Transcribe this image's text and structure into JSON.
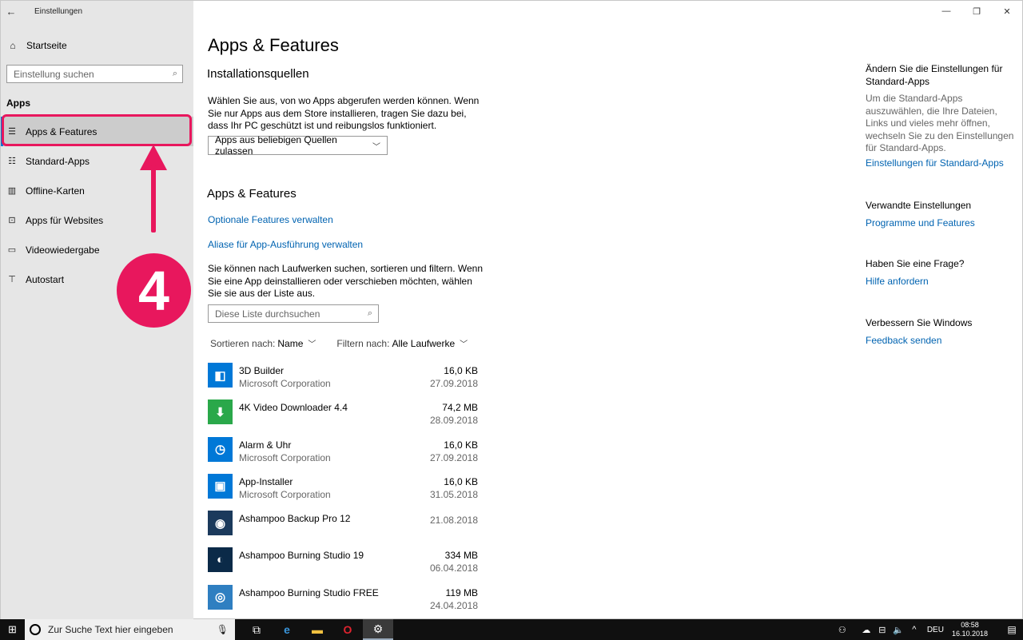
{
  "window": {
    "title": "Einstellungen",
    "controls": [
      "—",
      "❐",
      "✕"
    ]
  },
  "sidebar": {
    "home_label": "Startseite",
    "search_placeholder": "Einstellung suchen",
    "section_title": "Apps",
    "items": [
      {
        "label": "Apps & Features",
        "icon": "list-icon",
        "active": true
      },
      {
        "label": "Standard-Apps",
        "icon": "list-check-icon"
      },
      {
        "label": "Offline-Karten",
        "icon": "map-icon"
      },
      {
        "label": "Apps für Websites",
        "icon": "external-window-icon"
      },
      {
        "label": "Videowiedergabe",
        "icon": "video-icon"
      },
      {
        "label": "Autostart",
        "icon": "startup-icon"
      }
    ]
  },
  "annotation": {
    "step_number": "4",
    "accent_color": "#e8175d"
  },
  "main": {
    "title": "Apps & Features",
    "install_sources": {
      "heading": "Installationsquellen",
      "description": "Wählen Sie aus, von wo Apps abgerufen werden können. Wenn Sie nur Apps aus dem Store installieren, tragen Sie dazu bei, dass Ihr PC geschützt ist und reibungslos funktioniert.",
      "dropdown_value": "Apps aus beliebigen Quellen zulassen"
    },
    "apps_features": {
      "heading": "Apps & Features",
      "link_optional": "Optionale Features verwalten",
      "link_alias": "Aliase für App-Ausführung verwalten",
      "description": "Sie können nach Laufwerken suchen, sortieren und filtern. Wenn Sie eine App deinstallieren oder verschieben möchten, wählen Sie sie aus der Liste aus.",
      "search_placeholder": "Diese Liste durchsuchen",
      "sort_label": "Sortieren nach:",
      "sort_value": "Name",
      "filter_label": "Filtern nach:",
      "filter_value": "Alle Laufwerke"
    },
    "apps": [
      {
        "name": "3D Builder",
        "publisher": "Microsoft Corporation",
        "size": "16,0 KB",
        "date": "27.09.2018",
        "icon_color": "#0078d7",
        "icon": "3d-builder-icon"
      },
      {
        "name": "4K Video Downloader 4.4",
        "publisher": "",
        "size": "74,2 MB",
        "date": "28.09.2018",
        "icon_color": "#2aa84a",
        "icon": "download-cloud-icon"
      },
      {
        "name": "Alarm & Uhr",
        "publisher": "Microsoft Corporation",
        "size": "16,0 KB",
        "date": "27.09.2018",
        "icon_color": "#0078d7",
        "icon": "alarm-clock-icon"
      },
      {
        "name": "App-Installer",
        "publisher": "Microsoft Corporation",
        "size": "16,0 KB",
        "date": "31.05.2018",
        "icon_color": "#0078d7",
        "icon": "package-icon"
      },
      {
        "name": "Ashampoo Backup Pro 12",
        "publisher": "",
        "size": "",
        "date": "21.08.2018",
        "icon_color": "#1b3a5c",
        "icon": "backup-icon"
      },
      {
        "name": "Ashampoo Burning Studio 19",
        "publisher": "",
        "size": "334 MB",
        "date": "06.04.2018",
        "icon_color": "#0b2a48",
        "icon": "burning-studio-icon"
      },
      {
        "name": "Ashampoo Burning Studio FREE",
        "publisher": "",
        "size": "119 MB",
        "date": "24.04.2018",
        "icon_color": "#2f7fc1",
        "icon": "disc-icon"
      }
    ]
  },
  "right_pane": {
    "default_apps": {
      "heading": "Ändern Sie die Einstellungen für Standard-Apps",
      "body": "Um die Standard-Apps auszuwählen, die Ihre Dateien, Links und vieles mehr öffnen, wechseln Sie zu den Einstellungen für Standard-Apps.",
      "link": "Einstellungen für Standard-Apps"
    },
    "related": {
      "heading": "Verwandte Einstellungen",
      "link": "Programme und Features"
    },
    "question": {
      "heading": "Haben Sie eine Frage?",
      "link": "Hilfe anfordern"
    },
    "improve": {
      "heading": "Verbessern Sie Windows",
      "link": "Feedback senden"
    }
  },
  "taskbar": {
    "search_placeholder": "Zur Suche Text hier eingeben",
    "language": "DEU",
    "time": "08:58",
    "date": "16.10.2018"
  }
}
